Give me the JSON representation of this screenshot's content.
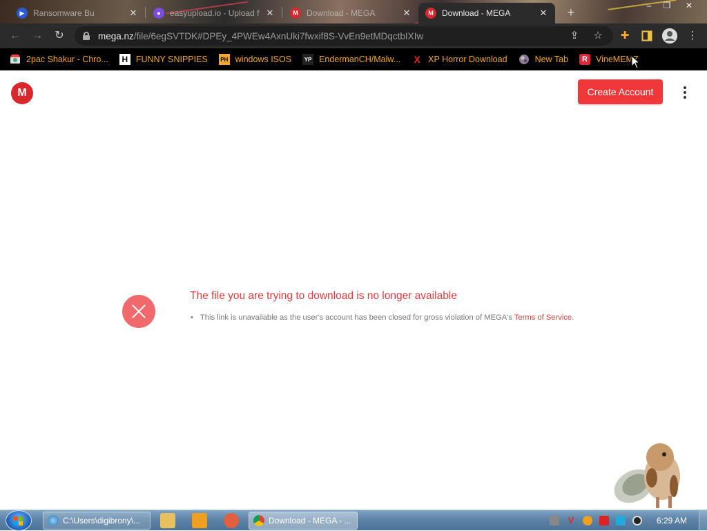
{
  "browser": {
    "tabs": [
      {
        "title": "Ransomware Bu",
        "favicon": "blue-play-icon",
        "active": false
      },
      {
        "title": "easyupload.io - Upload f",
        "favicon": "easyupload-icon",
        "active": false
      },
      {
        "title": "Download - MEGA",
        "favicon": "mega-icon",
        "active": false
      },
      {
        "title": "Download - MEGA",
        "favicon": "mega-icon",
        "active": true
      }
    ],
    "new_tab": "+",
    "url_host": "mega.nz",
    "url_path": "/file/6egSVTDK#DPEy_4PWEw4AxnUki7fwxif8S-VvEn9etMDqctbIXIw"
  },
  "bookmarks": [
    {
      "label": "2pac Shakur - Chro...",
      "icon_text": "",
      "icon": "chrome-store-icon"
    },
    {
      "label": "FUNNY SNIPPIES",
      "icon_text": "H",
      "icon": "h-icon"
    },
    {
      "label": "windows ISOS",
      "icon_text": "PH",
      "icon": "ph-icon"
    },
    {
      "label": "EndermanCH/Malw...",
      "icon_text": "YP",
      "icon": "yp-icon"
    },
    {
      "label": "XP Horror Download",
      "icon_text": "X",
      "icon": "x-icon"
    },
    {
      "label": "New Tab",
      "icon_text": "",
      "icon": "globe-icon"
    },
    {
      "label": "VineMEMZ",
      "icon_text": "R",
      "icon": "r-icon"
    }
  ],
  "page": {
    "logo_text": "M",
    "create_account": "Create Account",
    "error_title": "The file you are trying to download is no longer available",
    "error_detail": "This link is unavailable as the user's account has been closed for gross violation of MEGA's",
    "tos_link": "Terms of Service",
    "tos_suffix": "."
  },
  "taskbar": {
    "items": [
      {
        "label": "C:\\Users\\digibrony\\...",
        "icon": "ie-icon",
        "active": false
      },
      {
        "label": "Download - MEGA - ...",
        "icon": "chrome-icon",
        "active": true
      }
    ],
    "clock": "6:29 AM"
  },
  "colors": {
    "mega_red": "#d9272e",
    "button_red": "#f0373a",
    "error_red": "#e23a3d",
    "bookmark_text": "#f0a830"
  }
}
